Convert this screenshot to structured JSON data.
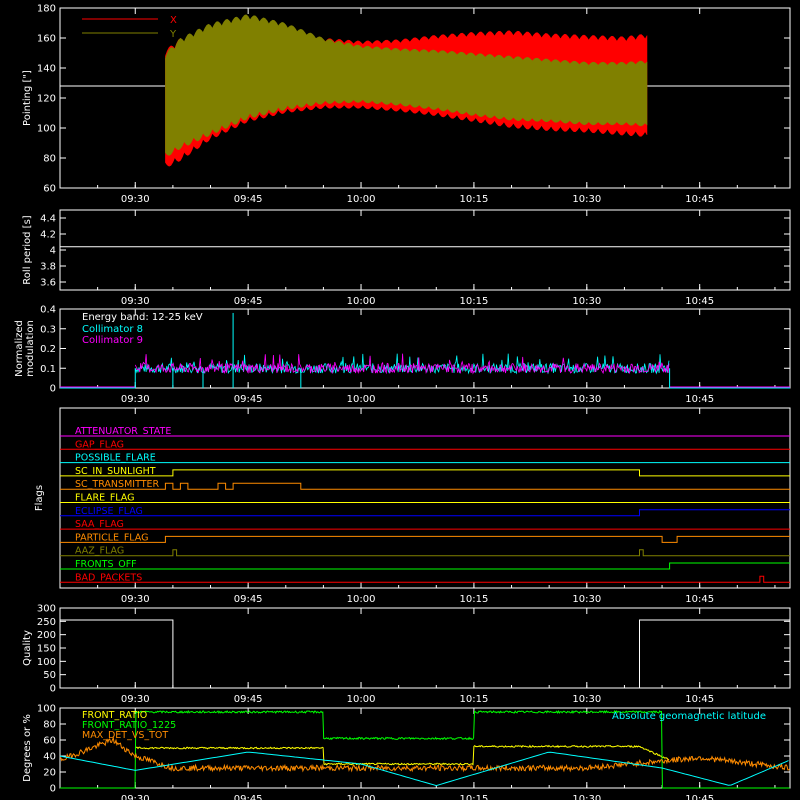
{
  "time_axis": {
    "x_range": [
      "09:20",
      "10:57"
    ],
    "tick_labels": [
      "09:30",
      "09:45",
      "10:00",
      "10:15",
      "10:30",
      "10:45"
    ]
  },
  "chart_data": [
    {
      "type": "line",
      "id": "pointing",
      "ylabel": "Pointing [\"]",
      "ylim": [
        60,
        180
      ],
      "yticks": [
        60,
        80,
        100,
        120,
        140,
        160,
        180
      ],
      "legend": [
        {
          "name": "X",
          "color": "#ff0000"
        },
        {
          "name": "Y",
          "color": "#808000"
        }
      ],
      "reference_line": {
        "y": 128,
        "color": "#ffffff"
      },
      "data_span": [
        "09:34",
        "10:38"
      ],
      "series": [
        {
          "name": "X",
          "color": "#ff0000",
          "x": [
            "09:34",
            "09:36",
            "09:40",
            "09:45",
            "09:50",
            "09:55",
            "10:00",
            "10:05",
            "10:10",
            "10:15",
            "10:20",
            "10:25",
            "10:30",
            "10:35",
            "10:38"
          ],
          "y_upper": [
            152,
            160,
            168,
            172,
            168,
            160,
            158,
            159,
            162,
            164,
            165,
            163,
            162,
            161,
            163
          ],
          "y_lower": [
            73,
            78,
            92,
            104,
            110,
            113,
            113,
            111,
            108,
            104,
            100,
            98,
            97,
            95,
            94
          ]
        },
        {
          "name": "Y",
          "color": "#808000",
          "x": [
            "09:34",
            "09:36",
            "09:40",
            "09:45",
            "09:50",
            "09:55",
            "10:00",
            "10:05",
            "10:10",
            "10:15",
            "10:20",
            "10:25",
            "10:30",
            "10:35",
            "10:38"
          ],
          "y_upper": [
            150,
            160,
            170,
            176,
            170,
            160,
            155,
            153,
            152,
            150,
            148,
            146,
            144,
            144,
            145
          ],
          "y_lower": [
            80,
            86,
            95,
            106,
            112,
            116,
            117,
            115,
            112,
            108,
            105,
            104,
            102,
            102,
            101
          ]
        }
      ]
    },
    {
      "type": "line",
      "id": "roll_period",
      "ylabel": "Roll period [s]",
      "ylim": [
        3.5,
        4.5
      ],
      "yticks": [
        3.6,
        3.8,
        4.0,
        4.2,
        4.4
      ],
      "series": [
        {
          "name": "",
          "color": "#ffffff",
          "x": [
            "09:20",
            "10:57"
          ],
          "y": [
            4.04,
            4.04
          ]
        }
      ]
    },
    {
      "type": "line",
      "id": "modulation",
      "ylabel": "Normalized modulation",
      "ylim": [
        0,
        0.4
      ],
      "yticks": [
        0.0,
        0.1,
        0.2,
        0.3,
        0.4
      ],
      "annotation": "Energy band: 12-25 keV",
      "legend": [
        {
          "name": "Collimator 8",
          "color": "#00ffff"
        },
        {
          "name": "Collimator 9",
          "color": "#ff00ff"
        }
      ],
      "data_span": [
        "09:30",
        "10:41"
      ],
      "base_level": 0.1,
      "spikes": [
        {
          "x": "09:30",
          "y": 0.0
        },
        {
          "x": "09:30",
          "y": 0.1
        },
        {
          "x": "09:35",
          "y": 0.0
        },
        {
          "x": "09:39",
          "y": 0.0
        },
        {
          "x": "09:43",
          "y": 0.38
        },
        {
          "x": "09:43",
          "y": 0.0
        },
        {
          "x": "09:52",
          "y": 0.0
        },
        {
          "x": "10:41",
          "y": 0.1
        },
        {
          "x": "10:41",
          "y": 0.0
        }
      ]
    },
    {
      "type": "line",
      "id": "flags",
      "ylabel": "Flags",
      "flags": [
        {
          "name": "ATTENUATOR_STATE",
          "color": "#ff00ff",
          "transitions": []
        },
        {
          "name": "GAP_FLAG",
          "color": "#ff0000",
          "transitions": []
        },
        {
          "name": "POSSIBLE_FLARE",
          "color": "#00ffff",
          "transitions": []
        },
        {
          "name": "SC_IN_SUNLIGHT",
          "color": "#ffff00",
          "transitions": [
            [
              "09:35",
              1
            ],
            [
              "10:37",
              0
            ]
          ]
        },
        {
          "name": "SC_TRANSMITTER",
          "color": "#ff8c00",
          "transitions": [
            [
              "09:34",
              1
            ],
            [
              "09:35",
              0
            ],
            [
              "09:36",
              1
            ],
            [
              "09:37",
              0
            ],
            [
              "09:41",
              1
            ],
            [
              "09:42",
              0
            ],
            [
              "09:43",
              1
            ],
            [
              "09:52",
              0
            ]
          ]
        },
        {
          "name": "FLARE_FLAG",
          "color": "#ffff00",
          "transitions": []
        },
        {
          "name": "ECLIPSE_FLAG",
          "color": "#0000ff",
          "transitions": [
            [
              "09:35",
              0
            ],
            [
              "10:37",
              1
            ]
          ]
        },
        {
          "name": "SAA_FLAG",
          "color": "#ff0000",
          "transitions": []
        },
        {
          "name": "PARTICLE_FLAG",
          "color": "#ff8c00",
          "transitions": [
            [
              "09:34",
              1
            ],
            [
              "10:40",
              0
            ],
            [
              "10:42",
              1
            ]
          ]
        },
        {
          "name": "AAZ_FLAG",
          "color": "#808000",
          "transitions": [
            [
              "09:35",
              1
            ],
            [
              "09:35.5",
              0
            ],
            [
              "10:37",
              1
            ],
            [
              "10:37.5",
              0
            ]
          ]
        },
        {
          "name": "FRONTS_OFF",
          "color": "#00ff00",
          "transitions": [
            [
              "09:30",
              0
            ],
            [
              "10:41",
              1
            ]
          ]
        },
        {
          "name": "BAD_PACKETS",
          "color": "#ff0000",
          "transitions": [
            [
              "10:53",
              1
            ],
            [
              "10:53.5",
              0
            ]
          ]
        }
      ]
    },
    {
      "type": "line",
      "id": "quality",
      "ylabel": "Quality",
      "ylim": [
        0,
        300
      ],
      "yticks": [
        0,
        50,
        100,
        150,
        200,
        250,
        300
      ],
      "series": [
        {
          "name": "",
          "color": "#ffffff",
          "x": [
            "09:20",
            "09:35",
            "09:35",
            "10:37",
            "10:37",
            "10:57"
          ],
          "y": [
            255,
            255,
            0,
            0,
            255,
            255
          ]
        }
      ]
    },
    {
      "type": "line",
      "id": "ratios",
      "ylabel": "Degrees or %",
      "ylim": [
        0,
        100
      ],
      "yticks": [
        0,
        20,
        40,
        60,
        80,
        100
      ],
      "legend": [
        {
          "name": "FRONT_RATIO",
          "color": "#ffff00"
        },
        {
          "name": "FRONT_RATIO_1225",
          "color": "#00ff00"
        },
        {
          "name": "MAX_DET_VS_TOT",
          "color": "#ff8c00"
        }
      ],
      "annotation": "Absolute geomagnetic latitude",
      "annotation_color": "#00ffff",
      "series": [
        {
          "name": "FRONT_RATIO",
          "color": "#ffff00",
          "x": [
            "09:30",
            "09:45",
            "09:55",
            "09:55",
            "10:15",
            "10:15",
            "10:37",
            "10:41",
            "10:41"
          ],
          "y": [
            50,
            50,
            50,
            30,
            30,
            52,
            52,
            35,
            35
          ]
        },
        {
          "name": "FRONT_RATIO_1225",
          "color": "#00ff00",
          "x": [
            "09:20",
            "09:30",
            "09:30",
            "09:55",
            "09:55",
            "10:15",
            "10:15",
            "10:40",
            "10:40",
            "10:57"
          ],
          "y": [
            0,
            0,
            95,
            95,
            62,
            62,
            95,
            95,
            0,
            0
          ]
        },
        {
          "name": "MAX_DET_VS_TOT",
          "color": "#ff8c00",
          "x": [
            "09:20",
            "09:27",
            "09:30",
            "09:35",
            "10:00",
            "10:30",
            "10:45",
            "10:57"
          ],
          "y": [
            35,
            60,
            40,
            25,
            25,
            25,
            38,
            25
          ]
        },
        {
          "name": "Absolute geomagnetic latitude",
          "color": "#00ffff",
          "x": [
            "09:20",
            "09:30",
            "09:45",
            "10:00",
            "10:10",
            "10:25",
            "10:40",
            "10:49",
            "10:57"
          ],
          "y": [
            40,
            22,
            45,
            30,
            3,
            45,
            25,
            3,
            35
          ]
        }
      ]
    }
  ]
}
